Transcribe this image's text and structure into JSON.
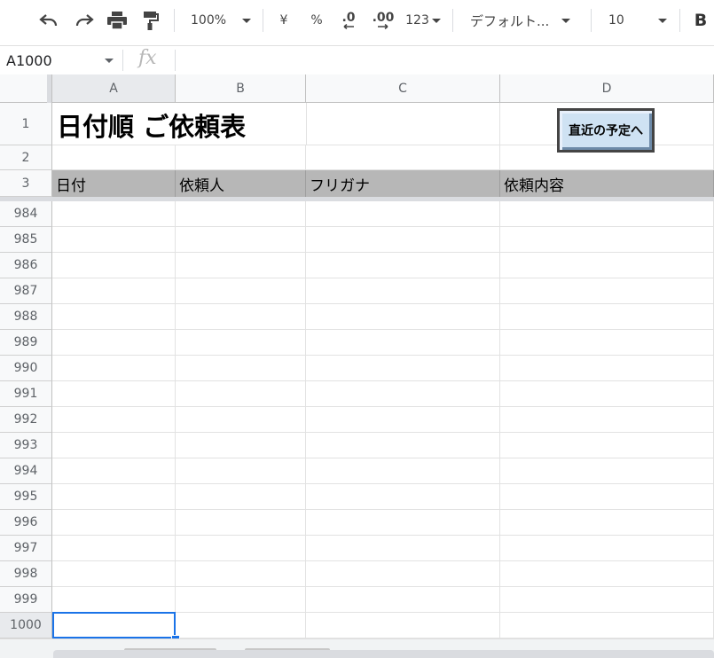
{
  "toolbar": {
    "zoom": "100%",
    "currency": "¥",
    "percent": "%",
    "decrease_decimal": ".0",
    "increase_decimal": ".00",
    "number_format": "123",
    "font": "デフォルト...",
    "font_size": "10",
    "bold": "B"
  },
  "formula_bar": {
    "name_box": "A1000",
    "fx": "fx",
    "value": ""
  },
  "columns": [
    "A",
    "B",
    "C",
    "D"
  ],
  "rows": {
    "r1": "1",
    "r2": "2",
    "r3": "3",
    "visible": [
      "984",
      "985",
      "986",
      "987",
      "988",
      "989",
      "990",
      "991",
      "992",
      "993",
      "994",
      "995",
      "996",
      "997",
      "998",
      "999",
      "1000"
    ]
  },
  "sheet": {
    "title": "日付順 ご依頼表",
    "button_label": "直近の予定へ",
    "headers": [
      "日付",
      "依頼人",
      "フリガナ",
      "依頼内容"
    ]
  },
  "selection": {
    "cell": "A1000"
  }
}
